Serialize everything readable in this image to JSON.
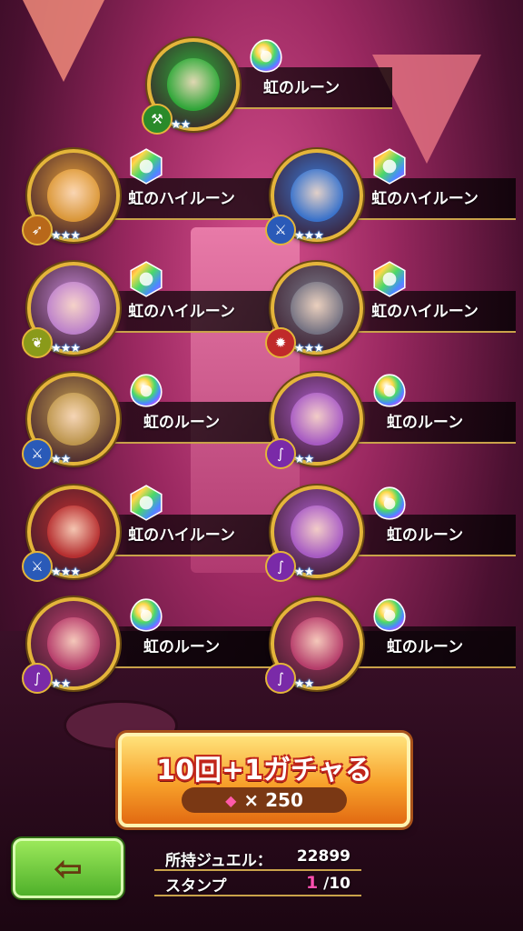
{
  "results": [
    {
      "rune": "虹のルーン",
      "stars": "★★",
      "type_icon": "axe",
      "color": "#2fb23a"
    },
    {
      "rune": "虹のハイルーン",
      "stars": "★★★",
      "type_icon": "bow",
      "color": "#e8a23a"
    },
    {
      "rune": "虹のハイルーン",
      "stars": "★★★",
      "type_icon": "sword",
      "color": "#3a7ad8"
    },
    {
      "rune": "虹のハイルーン",
      "stars": "★★★",
      "type_icon": "leaf",
      "color": "#c88ad8"
    },
    {
      "rune": "虹のハイルーン",
      "stars": "★★★",
      "type_icon": "flame",
      "color": "#7a7a8a"
    },
    {
      "rune": "虹のルーン",
      "stars": "★★",
      "type_icon": "sword",
      "color": "#c8a050"
    },
    {
      "rune": "虹のルーン",
      "stars": "★★",
      "type_icon": "staff",
      "color": "#b060d0"
    },
    {
      "rune": "虹のハイルーン",
      "stars": "★★★",
      "type_icon": "sword",
      "color": "#c03030"
    },
    {
      "rune": "虹のルーン",
      "stars": "★★",
      "type_icon": "staff",
      "color": "#b060d0"
    },
    {
      "rune": "虹のルーン",
      "stars": "★★",
      "type_icon": "staff",
      "color": "#c04070"
    },
    {
      "rune": "虹のルーン",
      "stars": "★★",
      "type_icon": "staff",
      "color": "#c04070"
    }
  ],
  "gacha_button": {
    "label": "10回+1ガチャる",
    "cost_icon": "jewel-icon",
    "cost_text": "× 250"
  },
  "back_button": {
    "icon": "left-arrow-icon",
    "glyph": "⇦"
  },
  "info": {
    "jewel_label": "所持ジュエル：",
    "jewel_value": "22899",
    "stamp_label": "スタンプ",
    "stamp_current": "1",
    "stamp_total": "/10"
  }
}
